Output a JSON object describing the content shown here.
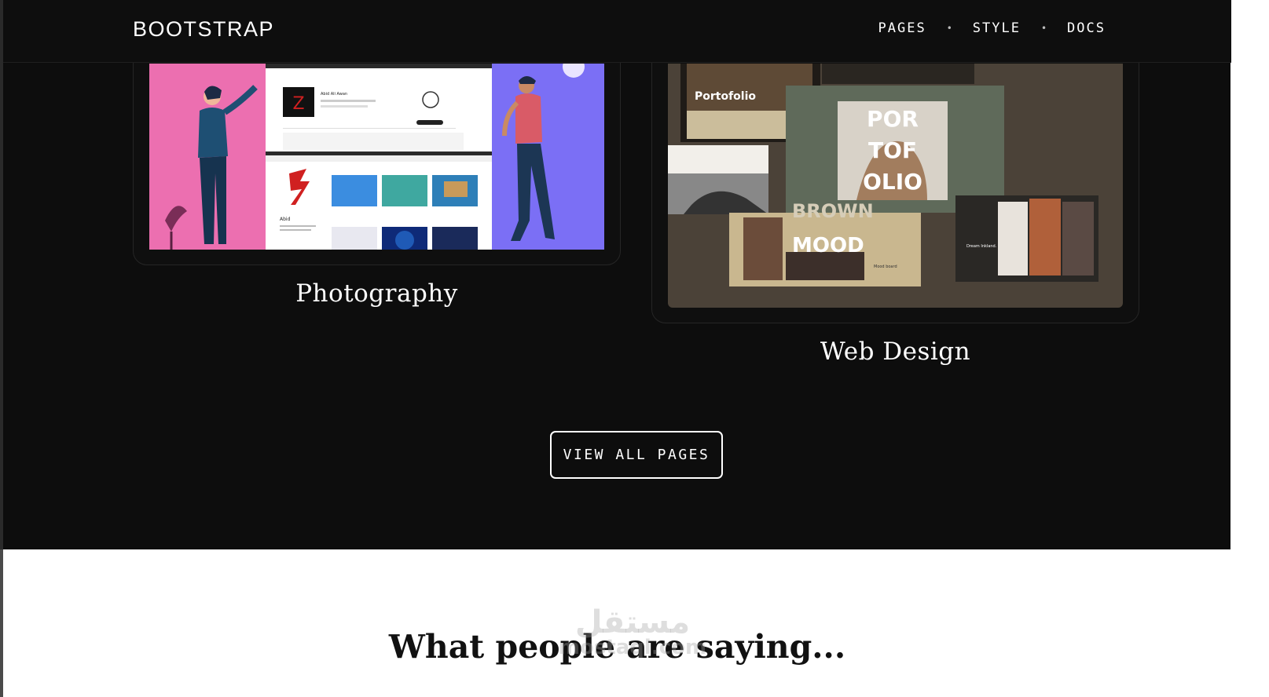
{
  "navbar": {
    "brand": "BOOTSTRAP",
    "links": [
      "PAGES",
      "STYLE",
      "DOCS"
    ],
    "separator": "•"
  },
  "cards": [
    {
      "title": "Photography"
    },
    {
      "title": "Web Design"
    }
  ],
  "thumb_1": {
    "profile_name": "Abid Ali Awan",
    "logo_letter": "Z",
    "caption": "Abid"
  },
  "thumb_2": {
    "portfolio_label": "Portofolio",
    "headline": [
      "POR",
      "TOF",
      "OLIO"
    ],
    "mood": "MOOD",
    "brown": "BROWN",
    "mood_board": "Mood board",
    "dream": "Dream Inkland."
  },
  "view_all_button": "VIEW ALL PAGES",
  "testimonials": {
    "heading": "What people are saying..."
  },
  "watermark": {
    "arabic": "مستقل",
    "latin": "mostaql.com"
  },
  "colors": {
    "background_dark": "#0d0d0d",
    "accent_pink": "#ec6fb0",
    "accent_purple": "#7b6ff5",
    "olive": "#5f6a5a"
  }
}
